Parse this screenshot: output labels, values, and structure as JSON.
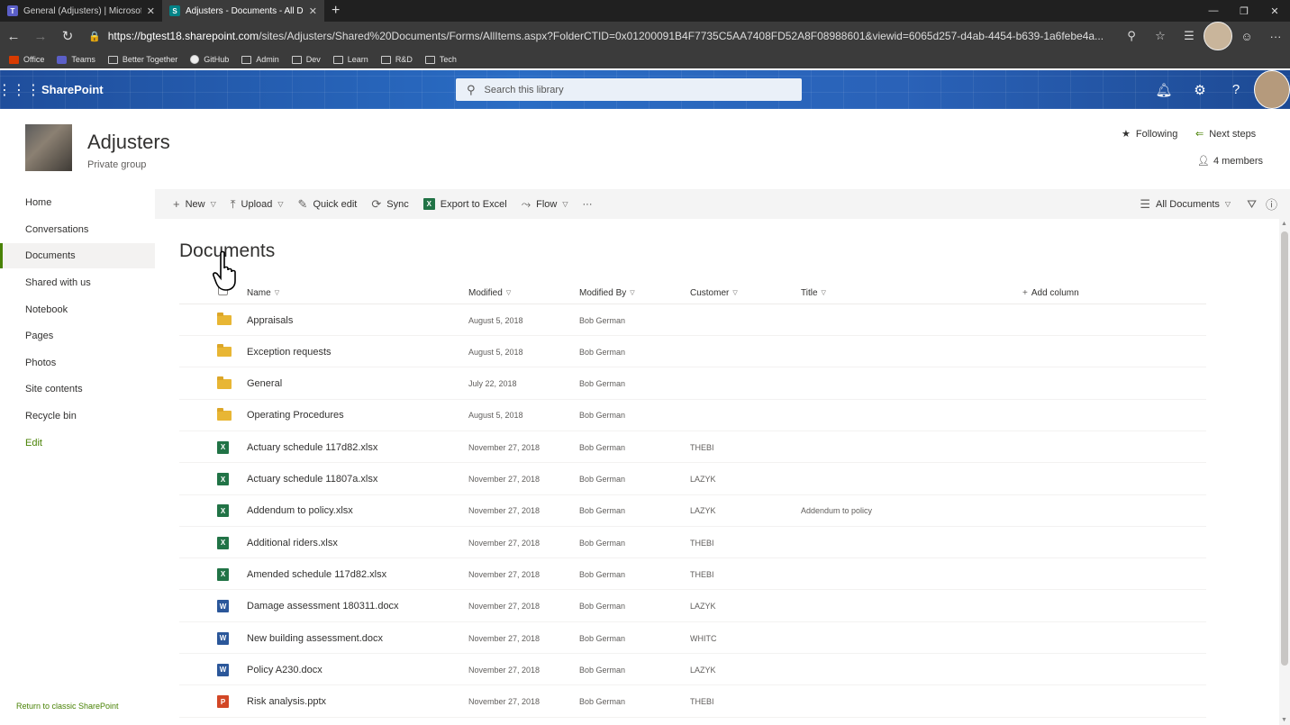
{
  "browser": {
    "tabs": [
      {
        "title": "General (Adjusters) | Microsoft Teams",
        "favicon": "teams-icon",
        "active": false
      },
      {
        "title": "Adjusters - Documents - All Documents",
        "favicon": "sharepoint-icon",
        "active": true
      }
    ],
    "url": "https://bgtest18.sharepoint.com/sites/Adjusters/Shared%20Documents/Forms/AllItems.aspx?FolderCTID=0x01200091B4F7735C5AA7408FD52A8F08988601&viewid=6065d257-d4ab-4454-b639-1a6febe4a...",
    "url_host": "https://bgtest18.sharepoint.com",
    "url_rest": "/sites/Adjusters/Shared%20Documents/Forms/AllItems.aspx?FolderCTID=0x01200091B4F7735C5AA7408FD52A8F08988601&viewid=6065d257-d4ab-4454-b639-1a6febe4a...",
    "bookmarks": [
      "Office",
      "Teams",
      "Better Together",
      "GitHub",
      "Admin",
      "Dev",
      "Learn",
      "R&D",
      "Tech"
    ]
  },
  "suite": {
    "brand": "SharePoint",
    "search_placeholder": "Search this library"
  },
  "site": {
    "title": "Adjusters",
    "subtitle": "Private group",
    "following": "Following",
    "next_steps": "Next steps",
    "members": "4 members"
  },
  "nav": {
    "items": [
      "Home",
      "Conversations",
      "Documents",
      "Shared with us",
      "Notebook",
      "Pages",
      "Photos",
      "Site contents",
      "Recycle bin"
    ],
    "edit": "Edit",
    "classic": "Return to classic SharePoint"
  },
  "commands": {
    "new": "New",
    "upload": "Upload",
    "quick_edit": "Quick edit",
    "sync": "Sync",
    "export": "Export to Excel",
    "flow": "Flow",
    "more": "···",
    "view": "All Documents"
  },
  "library": {
    "title": "Documents",
    "columns": {
      "name": "Name",
      "modified": "Modified",
      "modified_by": "Modified By",
      "customer": "Customer",
      "title": "Title",
      "add": "Add column"
    },
    "rows": [
      {
        "type": "folder",
        "name": "Appraisals",
        "modified": "August 5, 2018",
        "by": "Bob German",
        "customer": "",
        "title": ""
      },
      {
        "type": "folder",
        "name": "Exception requests",
        "modified": "August 5, 2018",
        "by": "Bob German",
        "customer": "",
        "title": ""
      },
      {
        "type": "folder",
        "name": "General",
        "modified": "July 22, 2018",
        "by": "Bob German",
        "customer": "",
        "title": ""
      },
      {
        "type": "folder",
        "name": "Operating Procedures",
        "modified": "August 5, 2018",
        "by": "Bob German",
        "customer": "",
        "title": ""
      },
      {
        "type": "xlsx",
        "name": "Actuary schedule 117d82.xlsx",
        "modified": "November 27, 2018",
        "by": "Bob German",
        "customer": "THEBI",
        "title": ""
      },
      {
        "type": "xlsx",
        "name": "Actuary schedule 11807a.xlsx",
        "modified": "November 27, 2018",
        "by": "Bob German",
        "customer": "LAZYK",
        "title": ""
      },
      {
        "type": "xlsx",
        "name": "Addendum to policy.xlsx",
        "modified": "November 27, 2018",
        "by": "Bob German",
        "customer": "LAZYK",
        "title": "Addendum to policy"
      },
      {
        "type": "xlsx",
        "name": "Additional riders.xlsx",
        "modified": "November 27, 2018",
        "by": "Bob German",
        "customer": "THEBI",
        "title": ""
      },
      {
        "type": "xlsx",
        "name": "Amended schedule 117d82.xlsx",
        "modified": "November 27, 2018",
        "by": "Bob German",
        "customer": "THEBI",
        "title": ""
      },
      {
        "type": "docx",
        "name": "Damage assessment 180311.docx",
        "modified": "November 27, 2018",
        "by": "Bob German",
        "customer": "LAZYK",
        "title": ""
      },
      {
        "type": "docx",
        "name": "New building assessment.docx",
        "modified": "November 27, 2018",
        "by": "Bob German",
        "customer": "WHITC",
        "title": ""
      },
      {
        "type": "docx",
        "name": "Policy A230.docx",
        "modified": "November 27, 2018",
        "by": "Bob German",
        "customer": "LAZYK",
        "title": ""
      },
      {
        "type": "pptx",
        "name": "Risk analysis.pptx",
        "modified": "November 27, 2018",
        "by": "Bob German",
        "customer": "THEBI",
        "title": ""
      }
    ]
  },
  "colors": {
    "accent_green": "#498205",
    "suite_blue": "#2a6cc4",
    "excel": "#217346",
    "word": "#2b579a",
    "powerpoint": "#d24726",
    "folder": "#e8b634"
  }
}
